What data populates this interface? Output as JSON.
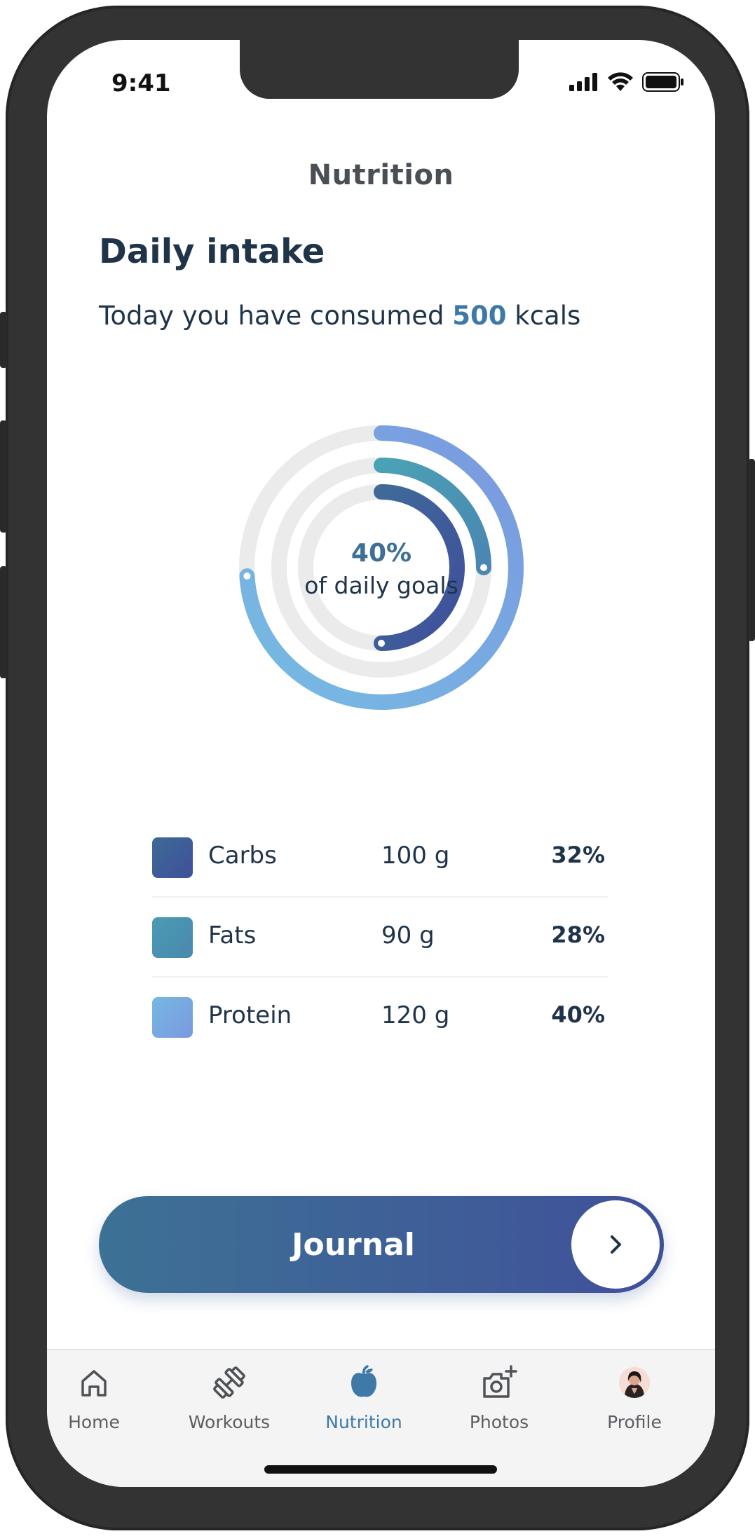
{
  "status_bar": {
    "time": "9:41"
  },
  "header": {
    "title": "Nutrition"
  },
  "intake": {
    "section_title": "Daily intake",
    "subtitle_prefix": "Today you have consumed ",
    "kcal_value": "500",
    "subtitle_suffix": " kcals"
  },
  "ring": {
    "center_percent": "40%",
    "center_label": "of daily goals",
    "levels": {
      "protein": 0.74,
      "fats": 0.25,
      "carbs": 0.5
    }
  },
  "macros": [
    {
      "name": "Carbs",
      "amount": "100 g",
      "percent": "32%",
      "color_start": "#3e6a95",
      "color_end": "#3f509a"
    },
    {
      "name": "Fats",
      "amount": "90 g",
      "percent": "28%",
      "color_start": "#4a9bb2",
      "color_end": "#4a88b0"
    },
    {
      "name": "Protein",
      "amount": "120 g",
      "percent": "40%",
      "color_start": "#76b8e2",
      "color_end": "#7a99e0"
    }
  ],
  "journal_button": {
    "label": "Journal"
  },
  "tabbar": {
    "items": [
      {
        "label": "Home",
        "icon": "home-icon",
        "active": false
      },
      {
        "label": "Workouts",
        "icon": "dumbbell-icon",
        "active": false
      },
      {
        "label": "Nutrition",
        "icon": "apple-icon",
        "active": true
      },
      {
        "label": "Photos",
        "icon": "camera-add-icon",
        "active": false
      },
      {
        "label": "Profile",
        "icon": "avatar",
        "active": false
      }
    ]
  },
  "colors": {
    "accent": "#3f79a8",
    "text_dark": "#1f3349",
    "ring_track": "#ebebeb"
  }
}
